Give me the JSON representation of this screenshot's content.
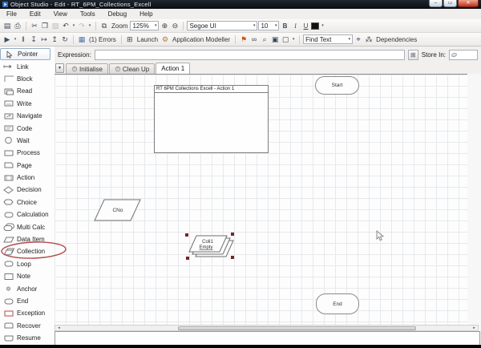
{
  "window": {
    "title": "Object Studio  - Edit - RT_6PM_Collections_Excell",
    "minimize_glyph": "–",
    "maximize_glyph": "▭",
    "close_glyph": "✕"
  },
  "menu": {
    "items": [
      "File",
      "Edit",
      "View",
      "Tools",
      "Debug",
      "Help"
    ]
  },
  "toolbar_main": {
    "items": [
      {
        "t": "btn",
        "name": "save-icon",
        "g": "▤"
      },
      {
        "t": "btn",
        "name": "print-icon",
        "g": "⎙"
      },
      {
        "t": "sep"
      },
      {
        "t": "btn",
        "name": "cut-icon",
        "g": "✂"
      },
      {
        "t": "btn",
        "name": "copy-icon",
        "g": "❐"
      },
      {
        "t": "btn",
        "name": "paste-icon",
        "g": "▨",
        "dis": true
      },
      {
        "t": "btn",
        "name": "undo-icon",
        "g": "↶",
        "dd": true
      },
      {
        "t": "btn",
        "name": "redo-icon",
        "g": "↷",
        "dis": true,
        "dd": true
      },
      {
        "t": "sep"
      },
      {
        "t": "btn",
        "name": "export-page-icon",
        "g": "⧉"
      },
      {
        "t": "label",
        "name": "zoom-label",
        "text": "Zoom"
      },
      {
        "t": "combo",
        "name": "zoom-select",
        "text": "125%",
        "w": 36
      },
      {
        "t": "btn",
        "name": "zoom-in-icon",
        "g": "⊕"
      },
      {
        "t": "btn",
        "name": "zoom-out-icon",
        "g": "⊖"
      },
      {
        "t": "sep"
      },
      {
        "t": "combo",
        "name": "font-family-select",
        "text": "Segoe UI",
        "w": 88
      },
      {
        "t": "combo",
        "name": "font-size-select",
        "text": "10",
        "w": 26
      },
      {
        "t": "btn",
        "name": "bold-button",
        "text": "B",
        "cls": "bold"
      },
      {
        "t": "btn",
        "name": "italic-button",
        "text": "I",
        "cls": "italic"
      },
      {
        "t": "btn",
        "name": "underline-button",
        "text": "U",
        "cls": "underline"
      },
      {
        "t": "swatch",
        "name": "font-color-button",
        "dd": true
      }
    ]
  },
  "toolbar_debug": {
    "items": [
      {
        "t": "btn",
        "name": "play-icon",
        "g": "▶",
        "dd": true,
        "color": "#41505e"
      },
      {
        "t": "btn",
        "name": "pause-icon",
        "g": "‖"
      },
      {
        "t": "btn",
        "name": "step-in-icon",
        "g": "↧"
      },
      {
        "t": "btn",
        "name": "step-over-icon",
        "g": "↦"
      },
      {
        "t": "btn",
        "name": "step-out-icon",
        "g": "↥"
      },
      {
        "t": "btn",
        "name": "reset-icon",
        "g": "↻"
      },
      {
        "t": "sep"
      },
      {
        "t": "btn",
        "name": "validation-icon",
        "g": "▦",
        "color": "#5577aa"
      },
      {
        "t": "label",
        "name": "errors-label",
        "text": "(1) Errors"
      },
      {
        "t": "sep"
      },
      {
        "t": "btn",
        "name": "launch-icon",
        "g": "⊞"
      },
      {
        "t": "label",
        "name": "launch-label",
        "text": "Launch"
      },
      {
        "t": "btn",
        "name": "application-modeller-icon",
        "g": "⚙",
        "color": "#b07838"
      },
      {
        "t": "label",
        "name": "application-modeller-label",
        "text": "Application Modeller"
      },
      {
        "t": "sep"
      },
      {
        "t": "btn",
        "name": "flag-icon",
        "g": "⚑",
        "color": "#d25500"
      },
      {
        "t": "btn",
        "name": "link-mode-icon",
        "g": "∞"
      },
      {
        "t": "btn",
        "name": "search-icon",
        "g": "⌕"
      },
      {
        "t": "btn",
        "name": "grid-view-icon",
        "g": "▣"
      },
      {
        "t": "btn",
        "name": "outline-view-icon",
        "g": "▢",
        "dd": true
      },
      {
        "t": "sep"
      },
      {
        "t": "combo",
        "name": "find-text-select",
        "text": "Find Text",
        "w": 62
      },
      {
        "t": "btn",
        "name": "find-next-icon",
        "g": "⌖"
      },
      {
        "t": "btn",
        "name": "dependencies-icon",
        "g": "⁂"
      },
      {
        "t": "label",
        "name": "dependencies-label",
        "text": "Dependencies"
      }
    ]
  },
  "expression_bar": {
    "label": "Expression:",
    "value": "",
    "store_in_label": "Store In:",
    "store_in_value": ""
  },
  "tabs": [
    {
      "label": "Initialise",
      "active": false,
      "has_icon": true
    },
    {
      "label": "Clean Up",
      "active": false,
      "has_icon": true
    },
    {
      "label": "Action 1",
      "active": true,
      "has_icon": false
    }
  ],
  "sidebar": {
    "items": [
      {
        "label": "Pointer",
        "icon": "pointer",
        "selected": true
      },
      {
        "label": "Link",
        "icon": "link"
      },
      {
        "label": "Block",
        "icon": "block"
      },
      {
        "label": "Read",
        "icon": "read"
      },
      {
        "label": "Write",
        "icon": "write"
      },
      {
        "label": "Navigate",
        "icon": "navigate"
      },
      {
        "label": "Code",
        "icon": "code"
      },
      {
        "label": "Wait",
        "icon": "wait"
      },
      {
        "label": "Process",
        "icon": "process"
      },
      {
        "label": "Page",
        "icon": "page"
      },
      {
        "label": "Action",
        "icon": "action"
      },
      {
        "label": "Decision",
        "icon": "decision"
      },
      {
        "label": "Choice",
        "icon": "choice"
      },
      {
        "label": "Calculation",
        "icon": "calculation"
      },
      {
        "label": "Multi Calc",
        "icon": "multi-calc"
      },
      {
        "label": "Data Item",
        "icon": "data-item"
      },
      {
        "label": "Collection",
        "icon": "collection",
        "annotated": true
      },
      {
        "label": "Loop",
        "icon": "loop"
      },
      {
        "label": "Note",
        "icon": "note"
      },
      {
        "label": "Anchor",
        "icon": "anchor"
      },
      {
        "label": "End",
        "icon": "end"
      },
      {
        "label": "Exception",
        "icon": "exception"
      },
      {
        "label": "Recover",
        "icon": "recover"
      },
      {
        "label": "Resume",
        "icon": "resume"
      }
    ]
  },
  "canvas": {
    "action_box": {
      "title": "RT 6PM Collections Excell - Action 1"
    },
    "start_node": {
      "label": "Start"
    },
    "end_node": {
      "label": "End"
    },
    "data_item_node": {
      "label": "CNo"
    },
    "collection_node": {
      "name": "Coll1",
      "status": "Empty"
    }
  },
  "colors": {
    "selection_handle": "#7a2424",
    "annotation": "#b34a4a",
    "grid_line": "#e6e9ec"
  }
}
